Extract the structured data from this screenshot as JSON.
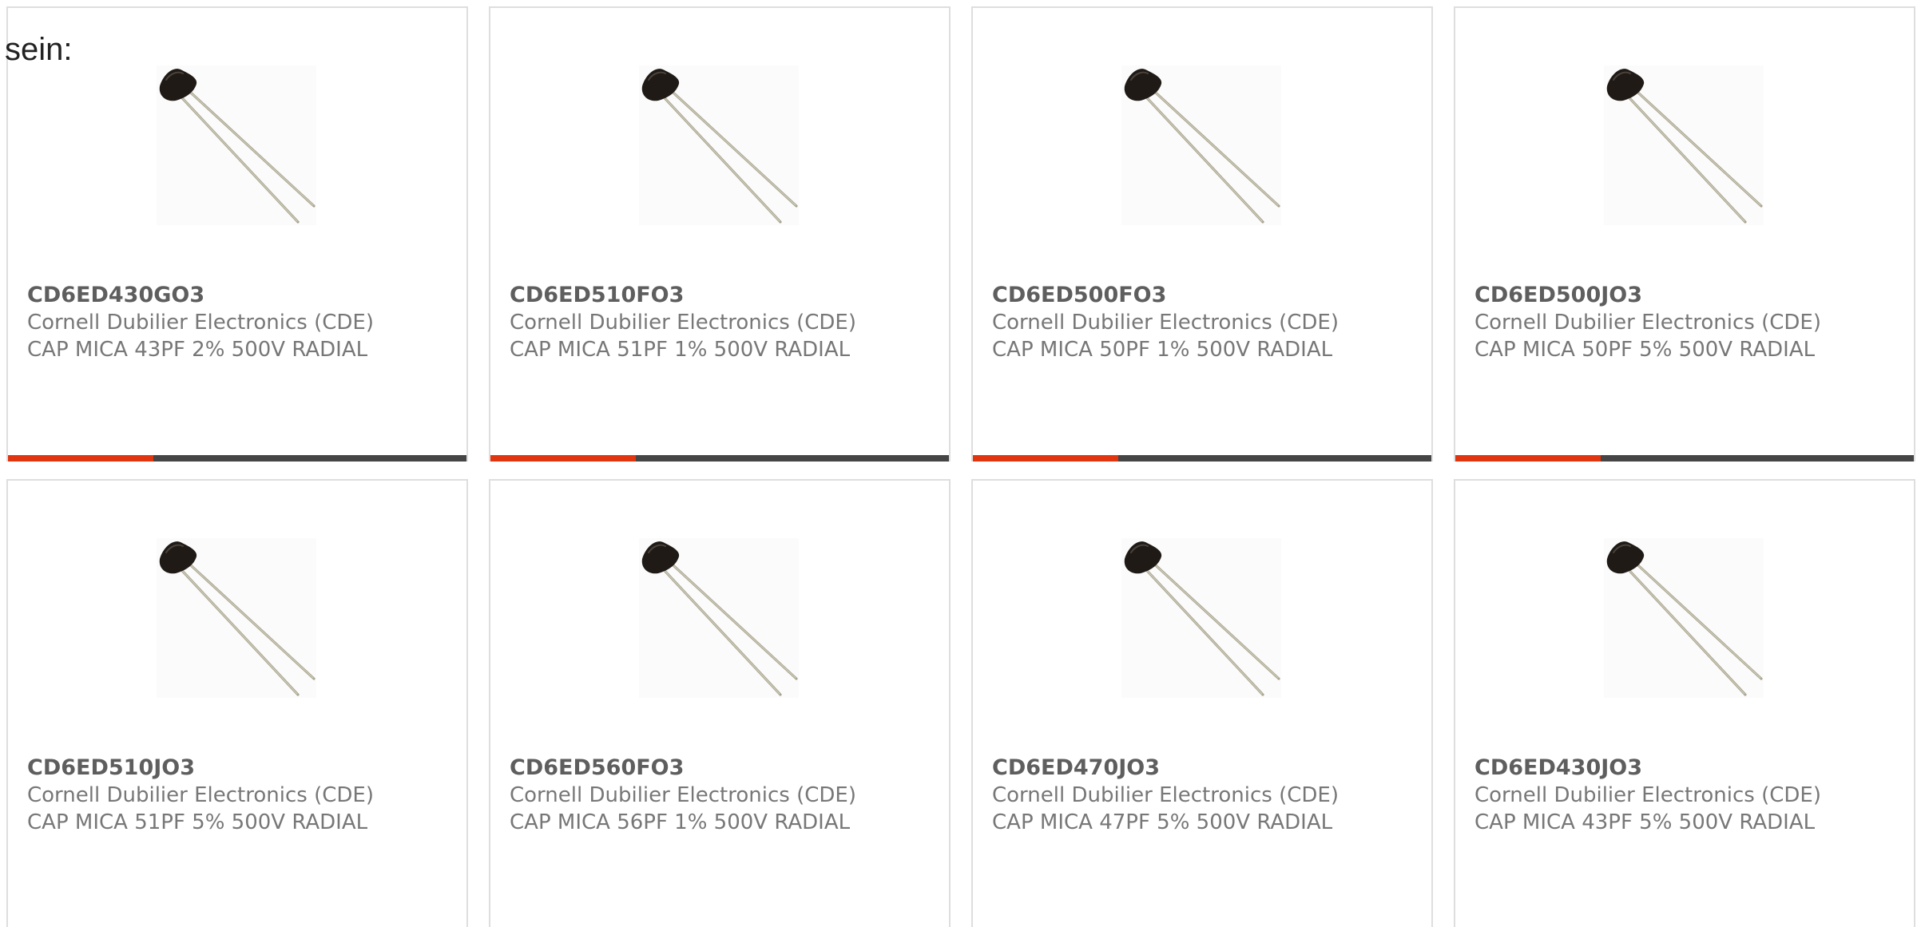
{
  "intro": "sein:",
  "colors": {
    "accent": "#e0350e",
    "bar": "#454545",
    "card_border": "#dedede",
    "part_number": "#5e5e5e",
    "secondary_text": "#777777"
  },
  "products": [
    {
      "part_number": "CD6ED430GO3",
      "manufacturer": "Cornell Dubilier Electronics (CDE)",
      "description": "CAP MICA 43PF 2% 500V RADIAL",
      "image": "radial-mica-capacitor"
    },
    {
      "part_number": "CD6ED510FO3",
      "manufacturer": "Cornell Dubilier Electronics (CDE)",
      "description": "CAP MICA 51PF 1% 500V RADIAL",
      "image": "radial-mica-capacitor"
    },
    {
      "part_number": "CD6ED500FO3",
      "manufacturer": "Cornell Dubilier Electronics (CDE)",
      "description": "CAP MICA 50PF 1% 500V RADIAL",
      "image": "radial-mica-capacitor"
    },
    {
      "part_number": "CD6ED500JO3",
      "manufacturer": "Cornell Dubilier Electronics (CDE)",
      "description": "CAP MICA 50PF 5% 500V RADIAL",
      "image": "radial-mica-capacitor"
    },
    {
      "part_number": "CD6ED510JO3",
      "manufacturer": "Cornell Dubilier Electronics (CDE)",
      "description": "CAP MICA 51PF 5% 500V RADIAL",
      "image": "radial-mica-capacitor"
    },
    {
      "part_number": "CD6ED560FO3",
      "manufacturer": "Cornell Dubilier Electronics (CDE)",
      "description": "CAP MICA 56PF 1% 500V RADIAL",
      "image": "radial-mica-capacitor"
    },
    {
      "part_number": "CD6ED470JO3",
      "manufacturer": "Cornell Dubilier Electronics (CDE)",
      "description": "CAP MICA 47PF 5% 500V RADIAL",
      "image": "radial-mica-capacitor"
    },
    {
      "part_number": "CD6ED430JO3",
      "manufacturer": "Cornell Dubilier Electronics (CDE)",
      "description": "CAP MICA 43PF 5% 500V RADIAL",
      "image": "radial-mica-capacitor"
    }
  ]
}
